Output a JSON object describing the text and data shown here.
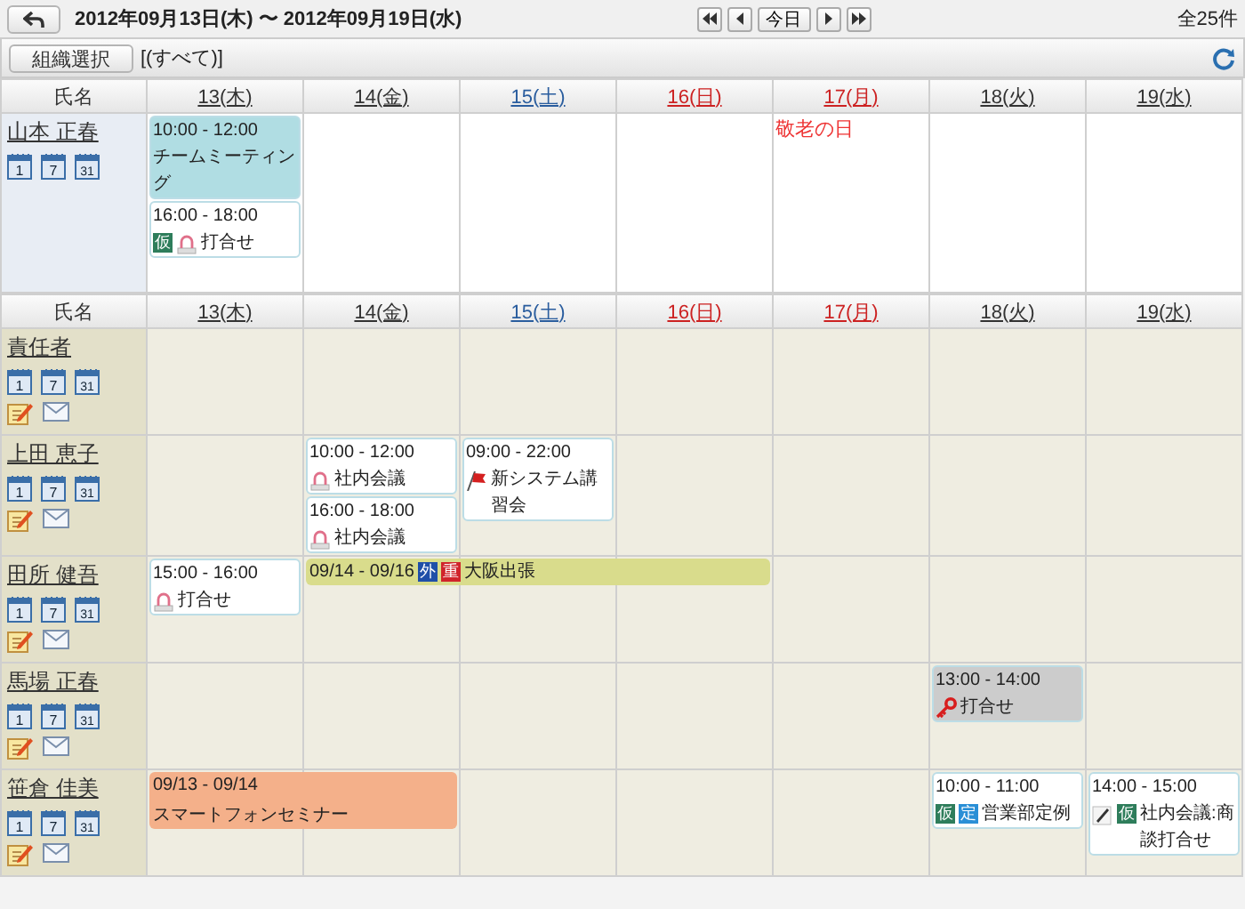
{
  "topbar": {
    "date_range": "2012年09月13日(木) 〜 2012年09月19日(水)",
    "today_button": "今日",
    "total": "全25件"
  },
  "toolbar": {
    "org_button": "組織選択",
    "org_filter": "[(すべて)]"
  },
  "sections": [
    {
      "kind": "personal",
      "name_header": "氏名",
      "days": [
        {
          "label": "13(木)",
          "color": "#333333"
        },
        {
          "label": "14(金)",
          "color": "#333333"
        },
        {
          "label": "15(土)",
          "color": "#2a5d9e"
        },
        {
          "label": "16(日)",
          "color": "#cc2222"
        },
        {
          "label": "17(月)",
          "color": "#cc2222"
        },
        {
          "label": "18(火)",
          "color": "#333333"
        },
        {
          "label": "19(水)",
          "color": "#333333"
        }
      ],
      "rows": [
        {
          "name": "山本 正春",
          "tools": false,
          "calendar_icons": [
            "1",
            "7",
            "31"
          ],
          "cells": [
            {
              "covered": false,
              "events": [
                {
                  "kind": "box",
                  "time": "10:00 - 12:00",
                  "title": "チームミーティング",
                  "color": "#b0dde3"
                },
                {
                  "kind": "box",
                  "time": "16:00 - 18:00",
                  "title": "打合せ",
                  "color": "#ffffff",
                  "badges": [
                    {
                      "kind": "tag",
                      "text": "仮",
                      "color": "#2e7d5b"
                    },
                    {
                      "kind": "meeting"
                    }
                  ]
                }
              ]
            },
            {
              "covered": false
            },
            {
              "covered": false
            },
            {
              "covered": false
            },
            {
              "covered": false,
              "note": "敬老の日"
            },
            {
              "covered": false
            },
            {
              "covered": false
            }
          ]
        }
      ]
    },
    {
      "kind": "group",
      "name_header": "氏名",
      "days": [
        {
          "label": "13(木)",
          "color": "#333333"
        },
        {
          "label": "14(金)",
          "color": "#333333"
        },
        {
          "label": "15(土)",
          "color": "#2a5d9e"
        },
        {
          "label": "16(日)",
          "color": "#cc2222"
        },
        {
          "label": "17(月)",
          "color": "#cc2222"
        },
        {
          "label": "18(火)",
          "color": "#333333"
        },
        {
          "label": "19(水)",
          "color": "#333333"
        }
      ],
      "rows": [
        {
          "name": "責任者",
          "tools": true,
          "calendar_icons": [
            "1",
            "7",
            "31"
          ],
          "cells": [
            {
              "covered": false
            },
            {
              "covered": false
            },
            {
              "covered": false
            },
            {
              "covered": false
            },
            {
              "covered": false
            },
            {
              "covered": false
            },
            {
              "covered": false
            }
          ]
        },
        {
          "name": "上田 恵子",
          "tools": true,
          "calendar_icons": [
            "1",
            "7",
            "31"
          ],
          "cells": [
            {
              "covered": false
            },
            {
              "covered": false,
              "events": [
                {
                  "kind": "box",
                  "time": "10:00 - 12:00",
                  "title": "社内会議",
                  "color": "#ffffff",
                  "badges": [
                    {
                      "kind": "meeting"
                    }
                  ]
                },
                {
                  "kind": "box",
                  "time": "16:00 - 18:00",
                  "title": "社内会議",
                  "color": "#ffffff",
                  "badges": [
                    {
                      "kind": "meeting"
                    }
                  ]
                }
              ]
            },
            {
              "covered": false,
              "events": [
                {
                  "kind": "box",
                  "time": "09:00 - 22:00",
                  "title": "新システム講習会",
                  "color": "#ffffff",
                  "badges": [
                    {
                      "kind": "flag"
                    }
                  ]
                }
              ]
            },
            {
              "covered": false
            },
            {
              "covered": false
            },
            {
              "covered": false
            },
            {
              "covered": false
            }
          ]
        },
        {
          "name": "田所 健吾",
          "tools": true,
          "calendar_icons": [
            "1",
            "7",
            "31"
          ],
          "cells": [
            {
              "covered": false,
              "events": [
                {
                  "kind": "box",
                  "time": "15:00 - 16:00",
                  "title": "打合せ",
                  "color": "#ffffff",
                  "badges": [
                    {
                      "kind": "meeting"
                    }
                  ]
                }
              ]
            },
            {
              "covered": false,
              "events": [
                {
                  "kind": "banner",
                  "time": "09/14 - 09/16",
                  "title": "大阪出張",
                  "color": "#d9dc8c",
                  "badges": [
                    {
                      "kind": "tag",
                      "text": "外",
                      "color": "#1f4fa8"
                    },
                    {
                      "kind": "tag",
                      "text": "重",
                      "color": "#d0242b"
                    }
                  ]
                }
              ]
            },
            {
              "covered": true
            },
            {
              "covered": true
            },
            {
              "covered": false
            },
            {
              "covered": false
            },
            {
              "covered": false
            }
          ]
        },
        {
          "name": "馬場 正春",
          "tools": true,
          "calendar_icons": [
            "1",
            "7",
            "31"
          ],
          "cells": [
            {
              "covered": false
            },
            {
              "covered": false
            },
            {
              "covered": false
            },
            {
              "covered": false
            },
            {
              "covered": false
            },
            {
              "covered": false,
              "events": [
                {
                  "kind": "box",
                  "time": "13:00 - 14:00",
                  "title": "打合せ",
                  "color": "#cccccc",
                  "badges": [
                    {
                      "kind": "key"
                    }
                  ]
                }
              ]
            },
            {
              "covered": false
            }
          ]
        },
        {
          "name": "笹倉 佳美",
          "tools": true,
          "calendar_icons": [
            "1",
            "7",
            "31"
          ],
          "cells": [
            {
              "covered": false,
              "events": [
                {
                  "kind": "banner",
                  "time": "09/13 - 09/14",
                  "title": "スマートフォンセミナー",
                  "color": "#f4b08a"
                }
              ]
            },
            {
              "covered": true
            },
            {
              "covered": false
            },
            {
              "covered": false
            },
            {
              "covered": false
            },
            {
              "covered": false,
              "events": [
                {
                  "kind": "box",
                  "time": "10:00 - 11:00",
                  "title": "営業部定例",
                  "color": "#ffffff",
                  "badges": [
                    {
                      "kind": "tag",
                      "text": "仮",
                      "color": "#2e7d5b"
                    },
                    {
                      "kind": "tag",
                      "text": "定",
                      "color": "#2a8fd6"
                    }
                  ]
                }
              ]
            },
            {
              "covered": false,
              "events": [
                {
                  "kind": "box",
                  "time": "14:00 - 15:00",
                  "title": "社内会議:商談打合せ",
                  "color": "#ffffff",
                  "badges": [
                    {
                      "kind": "memo"
                    },
                    {
                      "kind": "tag",
                      "text": "仮",
                      "color": "#2e7d5b"
                    }
                  ]
                }
              ]
            }
          ]
        }
      ]
    }
  ]
}
